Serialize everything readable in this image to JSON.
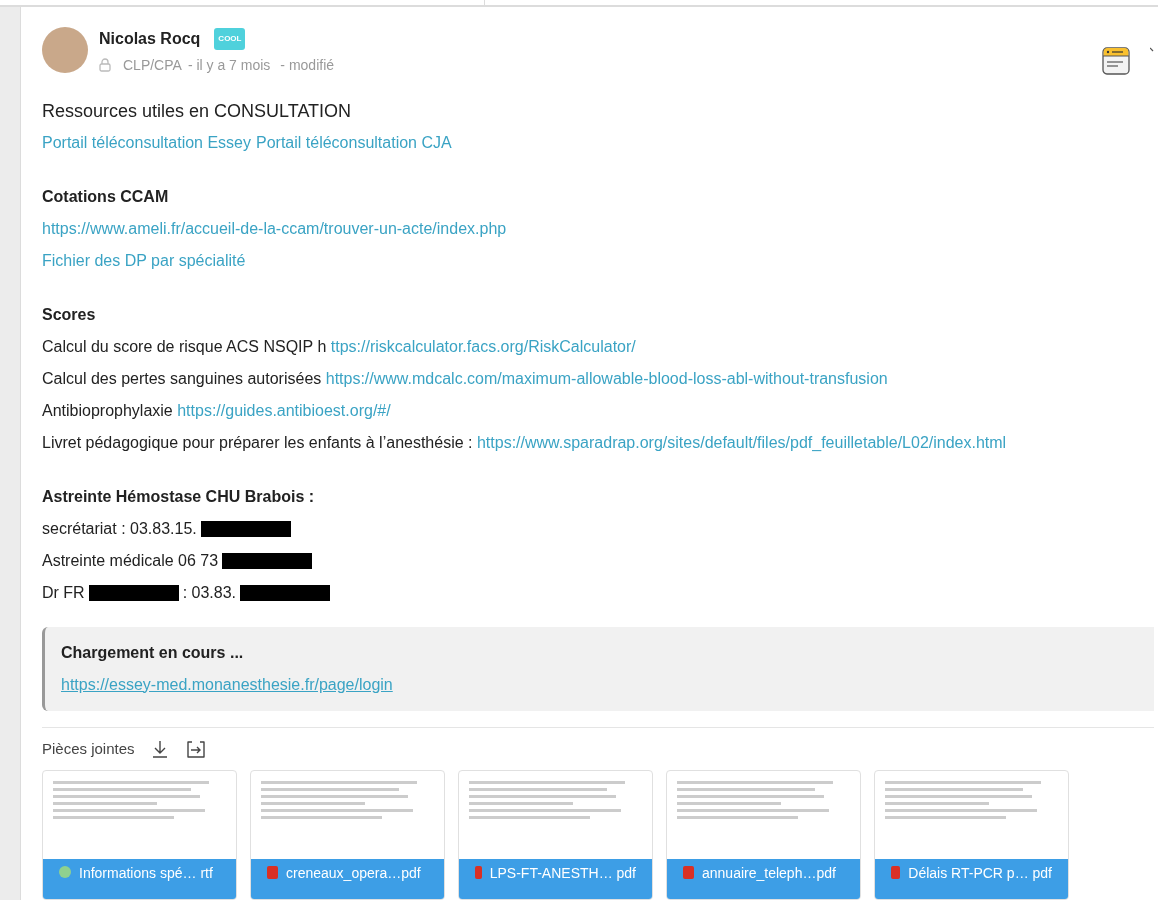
{
  "post": {
    "author": "Nicolas Rocq",
    "badge": "COOL",
    "meta": {
      "group": "CLP/CPA",
      "time": "- il y a 7 mois",
      "edited": "- modifié"
    }
  },
  "blocks": [
    {
      "kind": "title",
      "text": "Ressources utiles en CONSULTATION"
    },
    {
      "kind": "links",
      "links": [
        "Portail téléconsultation Essey",
        "Portail téléconsultation CJA"
      ]
    },
    {
      "kind": "heading",
      "text": "Cotations CCAM"
    },
    {
      "kind": "link",
      "text": "https://www.ameli.fr/accueil-de-la-ccam/trouver-un-acte/index.php"
    },
    {
      "kind": "link",
      "text": "Fichier des DP par spécialité"
    },
    {
      "kind": "heading",
      "text": "Scores"
    },
    {
      "kind": "text_link",
      "text": "Calcul du score de risque ACS NSQIP h",
      "link": "ttps://riskcalculator.facs.org/RiskCalculator/"
    },
    {
      "kind": "text_link",
      "text": "Calcul des pertes sanguines autorisées",
      "link": "https://www.mdcalc.com/maximum-allowable-blood-loss-abl-without-transfusion"
    },
    {
      "kind": "text_link",
      "text": "Antibioprophylaxie",
      "link": "https://guides.antibioest.org/#/"
    },
    {
      "kind": "text_link",
      "text": "Livret pédagogique pour préparer les enfants à l’anesthésie :",
      "link": "https://www.sparadrap.org/sites/default/files/pdf_feuilletable/L02/index.html"
    },
    {
      "kind": "heading",
      "text": "Astreinte Hémostase CHU Brabois :"
    },
    {
      "kind": "redacted",
      "parts": [
        {
          "kind": "text",
          "text": "secrétariat : 03.83.15."
        },
        {
          "kind": "redaction"
        }
      ]
    },
    {
      "kind": "redacted",
      "parts": [
        {
          "kind": "text",
          "text": "Astreinte médicale 06 73"
        },
        {
          "kind": "redaction"
        }
      ]
    },
    {
      "kind": "redacted",
      "parts": [
        {
          "kind": "text",
          "text": "Dr FR"
        },
        {
          "kind": "redaction"
        },
        {
          "kind": "text",
          "text": ": 03.83."
        },
        {
          "kind": "redaction"
        }
      ]
    }
  ],
  "quote": {
    "title": "Chargement en cours ...",
    "link": "https://essey-med.monanesthesie.fr/page/login"
  },
  "attachments": {
    "label": "Pièces jointes",
    "files": [
      {
        "name": "Informations spé… rtf",
        "kind": "rtf"
      },
      {
        "name": "creneaux_opera…pdf",
        "kind": "pdf"
      },
      {
        "name": "LPS-FT-ANESTH… pdf",
        "kind": "pdf"
      },
      {
        "name": "annuaire_teleph…pdf",
        "kind": "pdf"
      },
      {
        "name": "Délais RT-PCR p… pdf",
        "kind": "pdf"
      }
    ]
  }
}
